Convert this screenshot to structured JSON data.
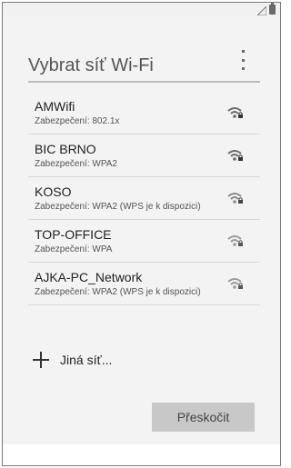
{
  "header": {
    "title": "Vybrat síť Wi-Fi"
  },
  "networks": [
    {
      "ssid": "AMWifi",
      "security": "Zabezpečení: 802.1x"
    },
    {
      "ssid": "BIC BRNO",
      "security": "Zabezpečení: WPA2"
    },
    {
      "ssid": "KOSO",
      "security": "Zabezpečení: WPA2 (WPS je k dispozici)"
    },
    {
      "ssid": "TOP-OFFICE",
      "security": "Zabezpečení: WPA"
    },
    {
      "ssid": "AJKA-PC_Network",
      "security": "Zabezpečení: WPA2 (WPS je k dispozici)"
    }
  ],
  "actions": {
    "other_network": "Jiná síť...",
    "skip": "Přeskočit"
  },
  "icons": {
    "status": [
      "signal-icon",
      "battery-icon"
    ],
    "menu": "overflow-menu-icon",
    "wifi": "wifi-locked-icon",
    "add": "plus-icon"
  }
}
